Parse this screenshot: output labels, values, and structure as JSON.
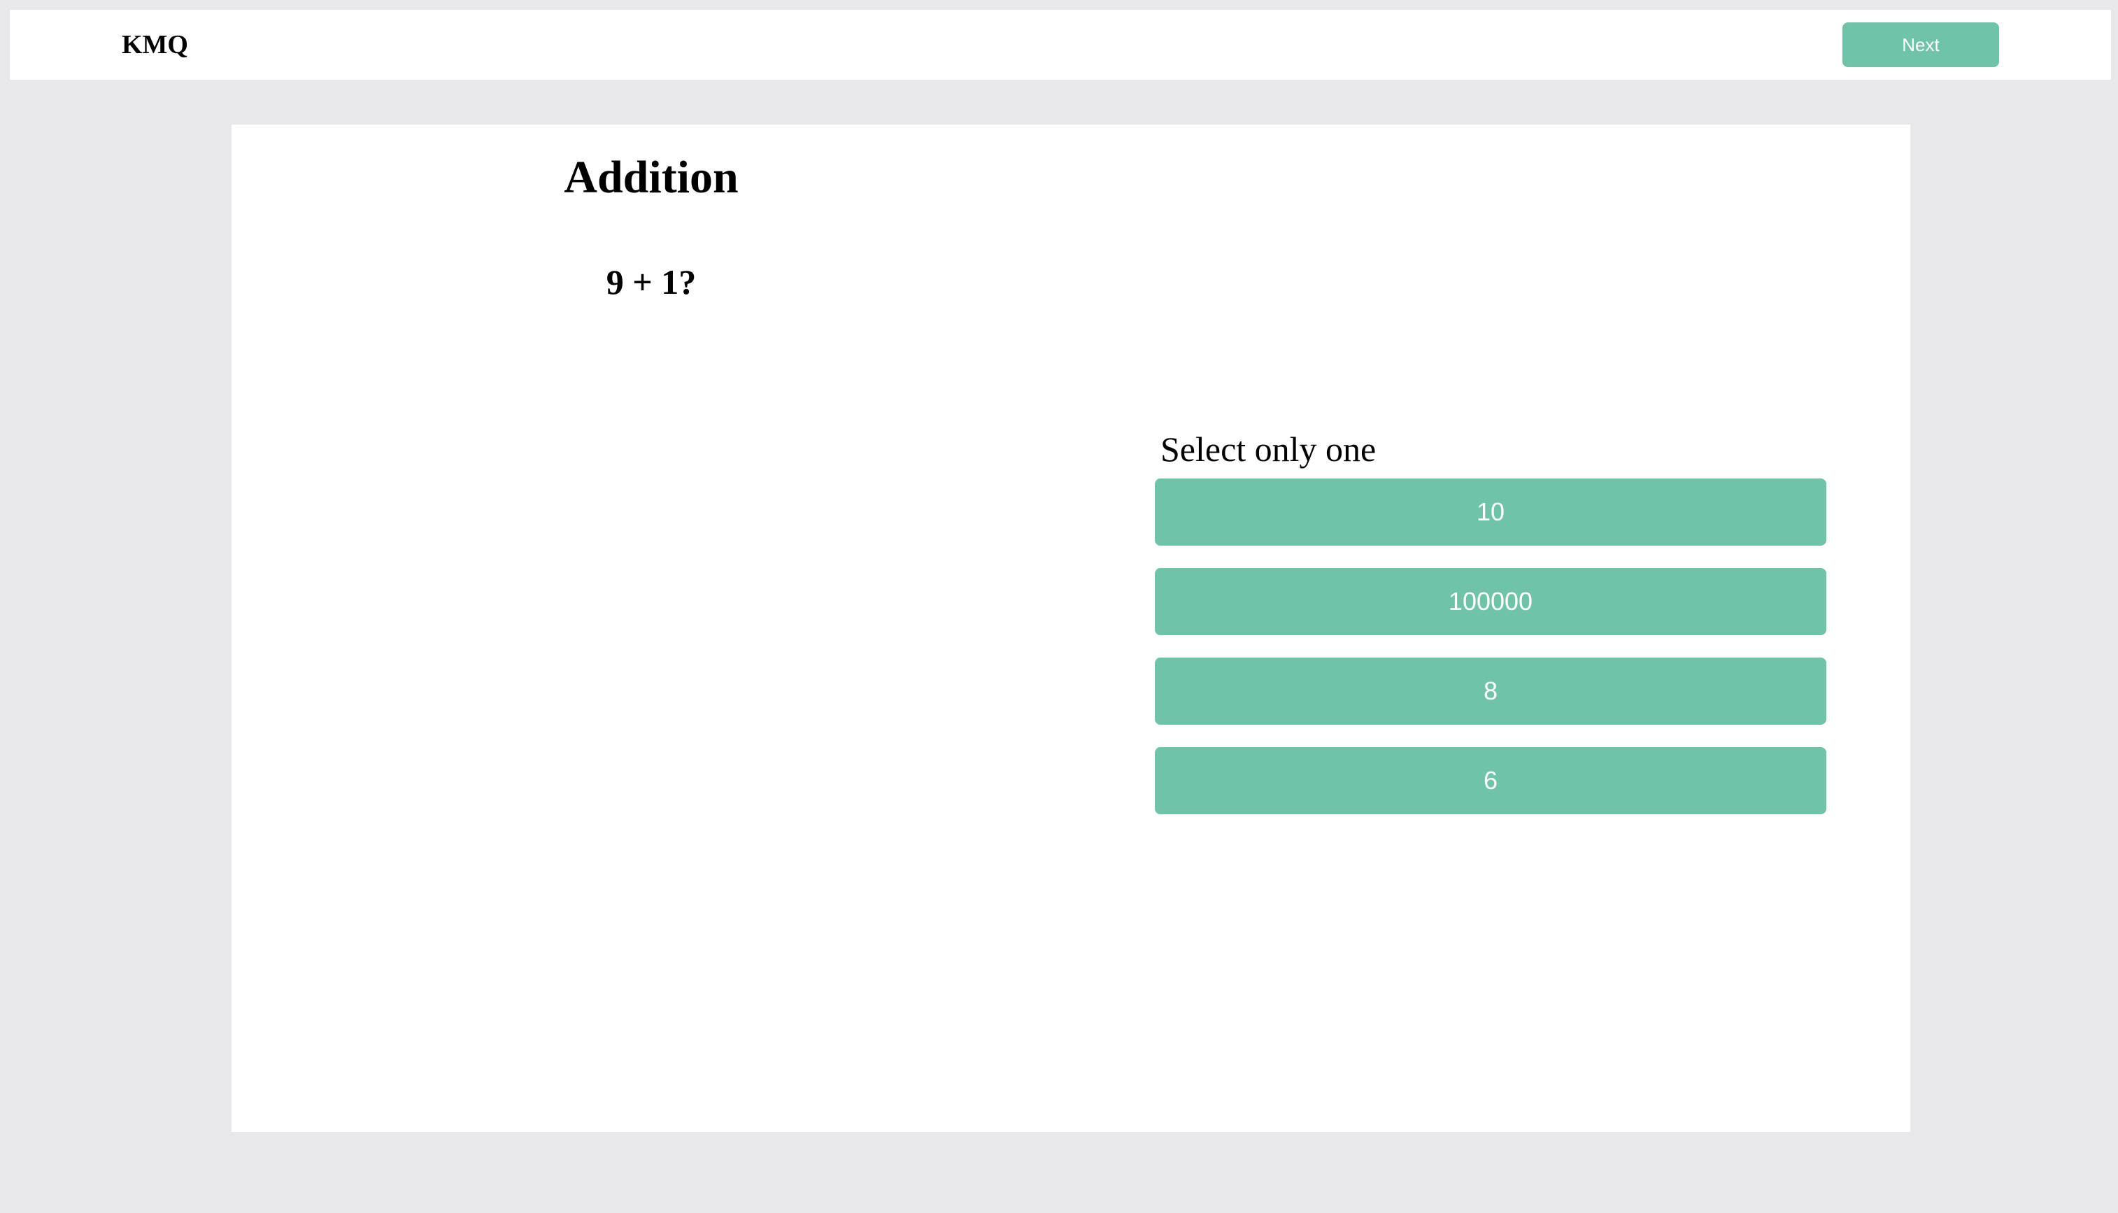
{
  "header": {
    "brand": "KMQ",
    "next_label": "Next"
  },
  "quiz": {
    "title": "Addition",
    "question": "9 + 1?",
    "instructions": "Select only one",
    "options": [
      {
        "label": "10"
      },
      {
        "label": "100000"
      },
      {
        "label": "8"
      },
      {
        "label": "6"
      }
    ]
  },
  "colors": {
    "accent": "#6fc3a8",
    "background": "#e8e8ea",
    "surface": "#ffffff"
  }
}
